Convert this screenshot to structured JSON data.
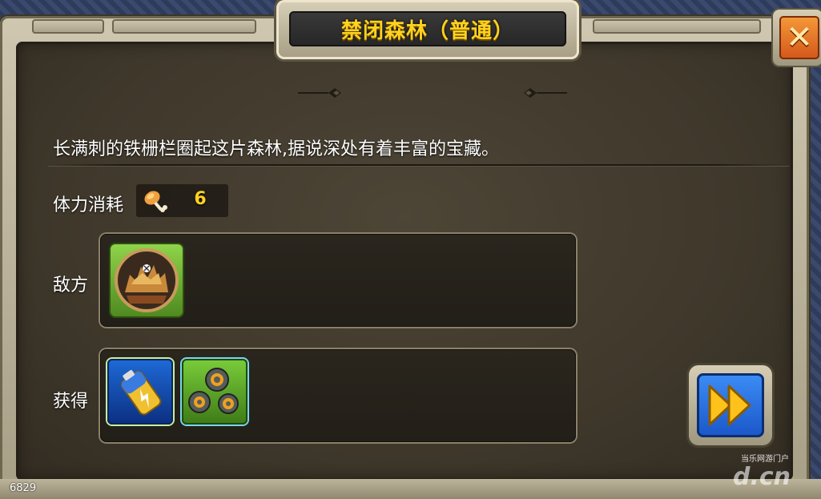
{
  "title": "禁闭森林（普通）",
  "description": "长满刺的铁栅栏圈起这片森林,据说深处有着丰富的宝藏。",
  "stamina": {
    "label": "体力消耗",
    "icon": "drumstick-icon",
    "value": "6"
  },
  "enemy": {
    "label": "敌方",
    "units": [
      {
        "icon": "forest-beast-portrait-icon"
      }
    ]
  },
  "rewards": {
    "label": "获得",
    "items": [
      {
        "icon": "energy-battery-icon"
      },
      {
        "icon": "gears-icon"
      }
    ]
  },
  "buttons": {
    "close_icon": "close-icon",
    "next_icon": "fast-forward-icon"
  },
  "footer": {
    "level": "6829"
  },
  "watermark": {
    "small": "当乐网游门户",
    "big": "d.cn"
  },
  "colors": {
    "title": "#ffd21f",
    "accent_orange": "#e8772a",
    "accent_blue": "#2a6fe0",
    "frame": "#b8af96",
    "panel": "#3f382b"
  }
}
